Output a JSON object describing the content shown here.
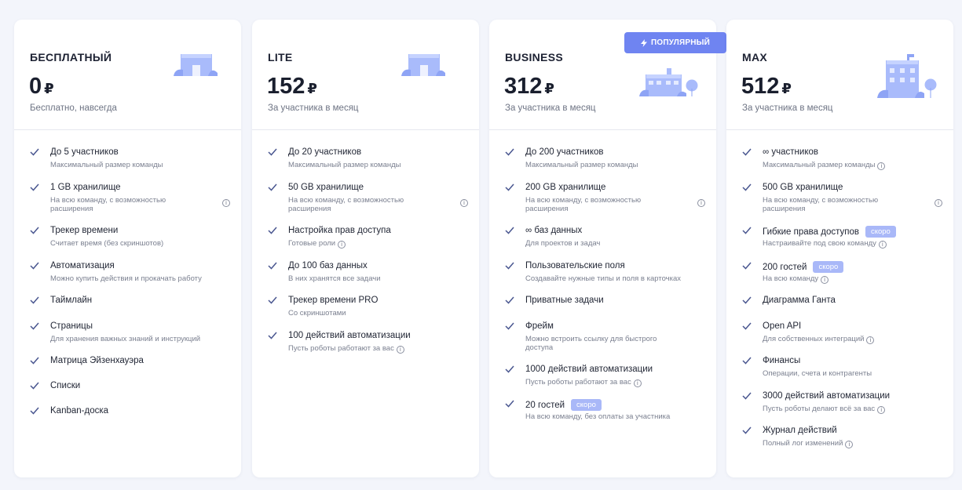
{
  "currency": "₽",
  "badge_popular": "ПОПУЛЯРНЫЙ",
  "plans": [
    {
      "name": "БЕСПЛАТНЫЙ",
      "price": "0",
      "price_sub": "Бесплатно, навсегда",
      "features": [
        {
          "title": "До 5 участников",
          "sub": "Максимальный размер команды"
        },
        {
          "title": "1 GB хранилище",
          "sub": "На всю команду, с возможностью расширения"
        },
        {
          "title": "Трекер времени",
          "sub": "Считает время (без скриншотов)"
        },
        {
          "title": "Автоматизация",
          "sub": "Можно купить действия и прокачать работу"
        },
        {
          "title": "Таймлайн",
          "sub": ""
        },
        {
          "title": "Страницы",
          "sub": "Для хранения важных знаний и инструкций"
        },
        {
          "title": "Матрица Эйзенхауэра",
          "sub": ""
        },
        {
          "title": "Списки",
          "sub": ""
        },
        {
          "title": "Kanban-доска",
          "sub": ""
        }
      ]
    },
    {
      "name": "LITE",
      "price": "152",
      "price_sub": "За участника в месяц",
      "features": [
        {
          "title": "До 20 участников",
          "sub": "Максимальный размер команды"
        },
        {
          "title": "50 GB хранилище",
          "sub": "На всю команду, с возможностью расширения"
        },
        {
          "title": "Настройка прав доступа",
          "sub": "Готовые роли"
        },
        {
          "title": "До 100 баз данных",
          "sub": "В них хранятся все задачи"
        },
        {
          "title": "Трекер времени PRO",
          "sub": "Со скриншотами"
        },
        {
          "title": "100 действий автоматизации",
          "sub": "Пусть роботы работают за вас"
        }
      ]
    },
    {
      "name": "BUSINESS",
      "price": "312",
      "price_sub": "За участника в месяц",
      "features": [
        {
          "title": "До 200 участников",
          "sub": "Максимальный размер команды"
        },
        {
          "title": "200 GB хранилище",
          "sub": "На всю команду, с возможностью расширения"
        },
        {
          "title": "∞ баз данных",
          "sub": "Для проектов и задач"
        },
        {
          "title": "Пользовательские поля",
          "sub": "Создавайте нужные типы и поля в карточках"
        },
        {
          "title": "Приватные задачи",
          "sub": ""
        },
        {
          "title": "Фрейм",
          "sub": "Можно встроить ссылку для быстрого доступа"
        },
        {
          "title": "1000 действий автоматизации",
          "sub": "Пусть роботы работают за вас"
        },
        {
          "title": "20 гостей",
          "sub": "На всю команду, без оплаты за участника",
          "tag": "скоро"
        }
      ]
    },
    {
      "name": "MAX",
      "price": "512",
      "price_sub": "За участника в месяц",
      "features": [
        {
          "title": "∞ участников",
          "sub": "Максимальный размер команды"
        },
        {
          "title": "500 GB хранилище",
          "sub": "На всю команду, с возможностью расширения"
        },
        {
          "title": "Гибкие права доступов",
          "sub": "Настраивайте под свою команду",
          "tag": "скоро"
        },
        {
          "title": "200 гостей",
          "sub": "На всю команду",
          "tag": "скоро"
        },
        {
          "title": "Диаграмма Ганта",
          "sub": ""
        },
        {
          "title": "Open API",
          "sub": "Для собственных интеграций"
        },
        {
          "title": "Финансы",
          "sub": "Операции, счета и контрагенты"
        },
        {
          "title": "3000 действий автоматизации",
          "sub": "Пусть роботы делают всё за вас"
        },
        {
          "title": "Журнал действий",
          "sub": "Полный лог изменений"
        }
      ]
    }
  ]
}
